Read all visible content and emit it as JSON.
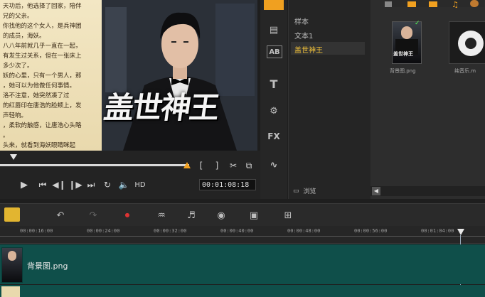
{
  "preview": {
    "story_lines": [
      "天功后，他选择了回家，陪伴",
      "兄的父亲。",
      "你找他的这个女人，是兵神团",
      "的成员，海妖。",
      "八八年前就几乎一直在一起，",
      "有发生过关系，但在一张床上",
      "多少次了。",
      "妖的心里，只有一个男人，那",
      "，她可以为他做任何事情。",
      "洛不注意，她突然凑了过",
      "的红唇印在唐浩的脸颊上，发",
      "声轻响。",
      "，柔软的触感，让唐浩心头略",
      "。",
      "头来，就看到海妖眼睛眯起"
    ],
    "poster_title": "盖世神王"
  },
  "player": {
    "timecode": "00:01:08:18",
    "hd_label": "HD"
  },
  "library": {
    "items": [
      "样本",
      "文本1",
      "盖世神王"
    ],
    "selected_index": 2,
    "browse_label": "浏览",
    "thumbs": [
      {
        "label": "背景图.png",
        "title": "盖世神王"
      },
      {
        "label": "纯音乐.m"
      }
    ]
  },
  "sidebar_icons": [
    "media-icon",
    "instant-project-icon",
    "transition-icon",
    "title-icon",
    "graphics-icon",
    "filter-icon",
    "path-icon"
  ],
  "sidebar_labels": {
    "ab": "AB",
    "t": "T",
    "fx": "FX"
  },
  "timeline": {
    "ruler": [
      "00:00:16:00",
      "00:00:24:00",
      "00:00:32:00",
      "00:00:40:00",
      "00:00:48:00",
      "00:00:56:00",
      "00:01:04:00"
    ],
    "track1_clip": "背景图.png"
  },
  "colors": {
    "accent": "#f0a020",
    "track": "#0f4f4a",
    "selected_text": "#f2c23a"
  }
}
